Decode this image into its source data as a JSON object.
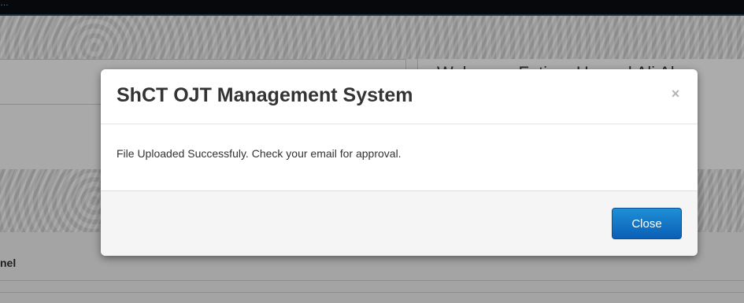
{
  "topbar": {
    "text": "…"
  },
  "background": {
    "welcome_text": "Welcome, Fatima Hamad Ali Al-",
    "panel_heading": "nel"
  },
  "modal": {
    "title": "ShCT OJT Management System",
    "close_icon": "×",
    "message": "File Uploaded Successfuly. Check your email for approval.",
    "close_button": "Close"
  },
  "colors": {
    "primary_button": "#1e8fd6",
    "overlay": "#a9a9a9",
    "topbar": "#06080c"
  }
}
